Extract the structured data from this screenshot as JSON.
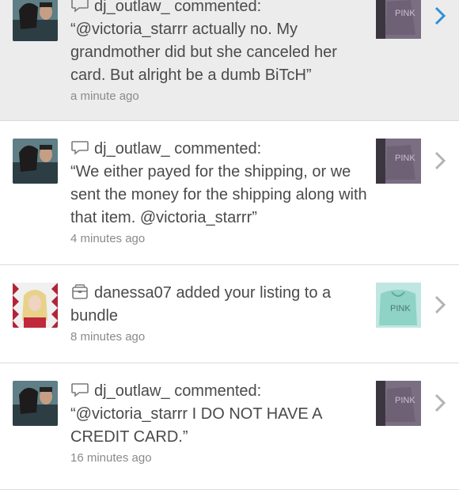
{
  "colors": {
    "row_unread_bg": "#ececec",
    "row_bg": "#ffffff",
    "text": "#4a4a4a",
    "muted": "#8a8a8a",
    "chevron_active": "#2f8fd6",
    "chevron": "#b3b3b3"
  },
  "notifications": [
    {
      "user": "dj_outlaw_",
      "action": "commented:",
      "icon": "comment-icon",
      "message": "“@victoria_starrr actually no. My grandmother did but she canceled her card. But alright be a dumb BiTcH”",
      "time": "a minute ago",
      "unread": true
    },
    {
      "user": "dj_outlaw_",
      "action": "commented:",
      "icon": "comment-icon",
      "message": "“We either payed for the shipping, or we sent the money for the shipping along with that item. @victoria_starrr”",
      "time": "4 minutes ago",
      "unread": false
    },
    {
      "user": "danessa07",
      "action": "added your listing to a bundle",
      "icon": "bundle-icon",
      "message": "",
      "time": "8 minutes ago",
      "unread": false
    },
    {
      "user": "dj_outlaw_",
      "action": "commented:",
      "icon": "comment-icon",
      "message": "“@victoria_starrr I DO NOT HAVE A CREDIT CARD.”",
      "time": "16 minutes ago",
      "unread": false
    }
  ]
}
